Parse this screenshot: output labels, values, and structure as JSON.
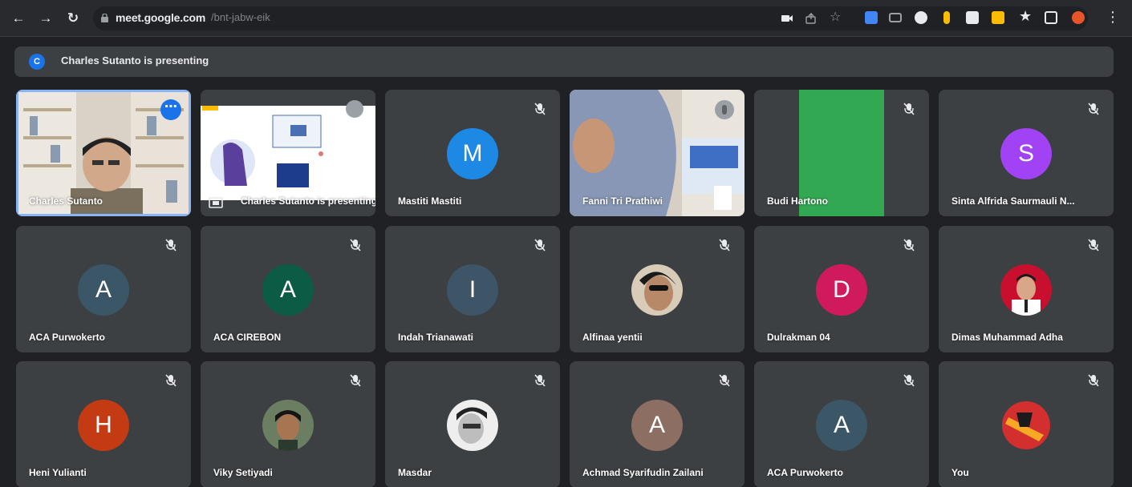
{
  "browser": {
    "url_host": "meet.google.com",
    "url_path": "/bnt-jabw-eik"
  },
  "banner": {
    "avatar_letter": "C",
    "text": "Charles Sutanto is presenting"
  },
  "colors": {
    "accent": "#1a73e8",
    "tile_bg": "#3c4043",
    "page_bg": "#202124"
  },
  "tiles": [
    {
      "name": "Charles Sutanto",
      "type": "video",
      "row": 0,
      "col": 0
    },
    {
      "name": "Charles Sutanto is presenting",
      "type": "presentation",
      "row": 0,
      "col": 1
    },
    {
      "name": "Mastiti Mastiti",
      "type": "avatar",
      "letter": "M",
      "color": "#1e88e5",
      "row": 0,
      "col": 2
    },
    {
      "name": "Fanni Tri Prathiwi",
      "type": "video",
      "row": 0,
      "col": 3
    },
    {
      "name": "Budi Hartono",
      "type": "video",
      "row": 0,
      "col": 4
    },
    {
      "name": "Sinta Alfrida Saurmauli N...",
      "type": "avatar",
      "letter": "S",
      "color": "#a142f4",
      "row": 0,
      "col": 5
    },
    {
      "name": "ACA Purwokerto",
      "type": "avatar",
      "letter": "A",
      "color": "#3b5666",
      "row": 1,
      "col": 0
    },
    {
      "name": "ACA CIREBON",
      "type": "avatar",
      "letter": "A",
      "color": "#0b5b45",
      "row": 1,
      "col": 1
    },
    {
      "name": "Indah Trianawati",
      "type": "avatar",
      "letter": "I",
      "color": "#3e5467",
      "row": 1,
      "col": 2
    },
    {
      "name": "Alfinaa yentii",
      "type": "photo",
      "row": 1,
      "col": 3
    },
    {
      "name": "Dulrakman 04",
      "type": "avatar",
      "letter": "D",
      "color": "#d01a5e",
      "row": 1,
      "col": 4
    },
    {
      "name": "Dimas Muhammad Adha",
      "type": "photo",
      "row": 1,
      "col": 5
    },
    {
      "name": "Heni Yulianti",
      "type": "avatar",
      "letter": "H",
      "color": "#c43a12",
      "row": 2,
      "col": 0
    },
    {
      "name": "Viky Setiyadi",
      "type": "photo",
      "row": 2,
      "col": 1
    },
    {
      "name": "Masdar",
      "type": "photo",
      "row": 2,
      "col": 2
    },
    {
      "name": "Achmad Syarifudin Zailani",
      "type": "avatar",
      "letter": "A",
      "color": "#8d6e63",
      "row": 2,
      "col": 3
    },
    {
      "name": "ACA Purwokerto",
      "type": "avatar",
      "letter": "A",
      "color": "#3b5666",
      "row": 2,
      "col": 4
    },
    {
      "name": "You",
      "type": "photo",
      "row": 2,
      "col": 5
    }
  ]
}
